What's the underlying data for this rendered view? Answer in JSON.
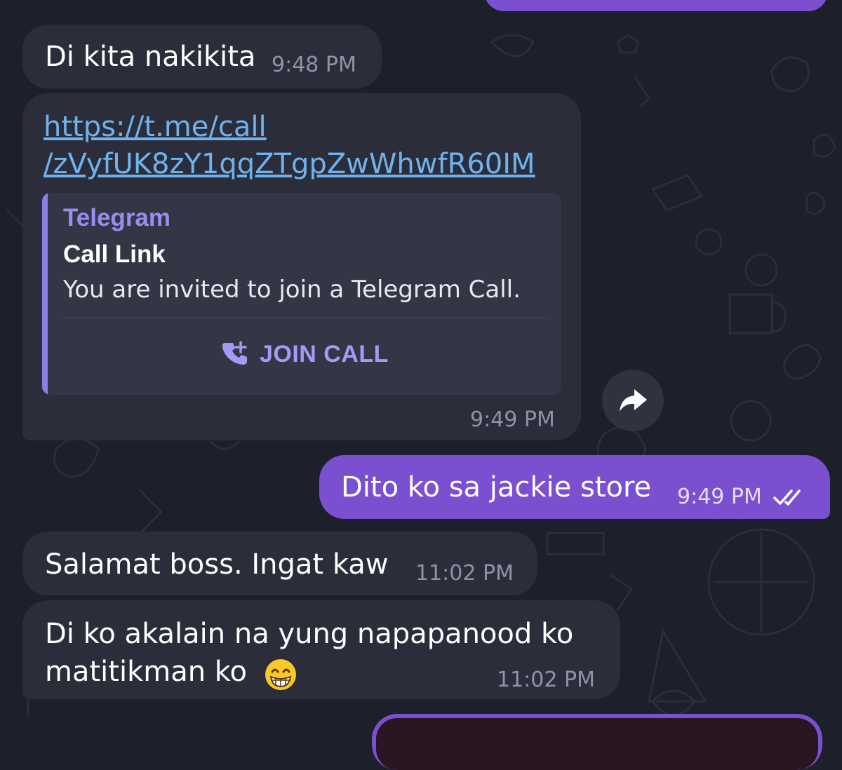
{
  "messages": [
    {
      "direction": "incoming",
      "text": "Di kita nakikita",
      "time": "9:48 PM"
    },
    {
      "direction": "incoming",
      "link_line1": "https://t.me/call",
      "link_line2": "/zVyfUK8zY1qqZTgpZwWhwfR60IM",
      "preview": {
        "site_name": "Telegram",
        "title": "Call Link",
        "description": "You are invited to join a Telegram Call.",
        "action_label": "JOIN CALL",
        "action_icon": "phone-plus-icon"
      },
      "time": "9:49 PM",
      "share_icon": "share-forward-icon"
    },
    {
      "direction": "outgoing",
      "text": "Dito ko sa jackie store",
      "time": "9:49 PM",
      "status_icon": "double-check-icon"
    },
    {
      "direction": "incoming",
      "text": "Salamat boss. Ingat kaw",
      "time": "11:02 PM"
    },
    {
      "direction": "incoming",
      "text_line1": "Di ko akalain na yung napapanood ko",
      "text_line2": "matitikman ko",
      "emoji": "grinning-face-with-smiling-eyes",
      "time": "11:02 PM"
    }
  ],
  "colors": {
    "background": "#1d1f2a",
    "incoming_bubble": "#2b2d3a",
    "outgoing_bubble": "#7a4fd0",
    "link": "#6fb3ee",
    "accent": "#9b8cf0"
  }
}
